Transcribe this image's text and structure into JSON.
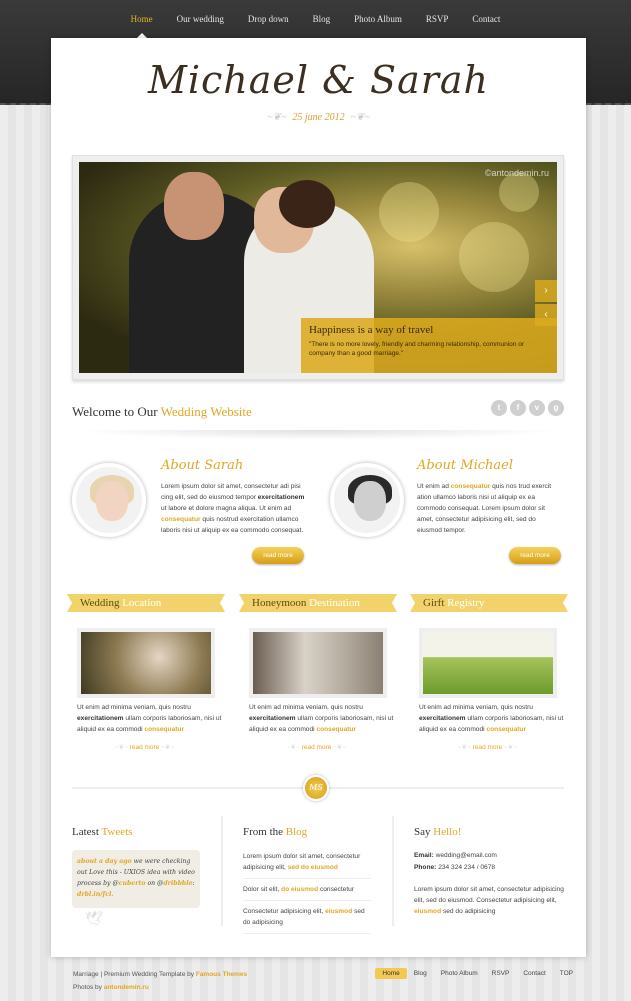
{
  "nav": {
    "items": [
      "Home",
      "Our wedding",
      "Drop down",
      "Blog",
      "Photo Album",
      "RSVP",
      "Contact"
    ],
    "active": "Home"
  },
  "header": {
    "couple_names": "Michael & Sarah",
    "date": "25 june 2012"
  },
  "slider": {
    "watermark": "©antondemin.ru",
    "caption_title": "Happiness is a way of travel",
    "caption_text": "\"There is no more lovely, friendly and charming relationship, communion or company than a good marriage.\"",
    "next_arrow": "›",
    "prev_arrow": "‹"
  },
  "welcome": {
    "prefix": "Welcome to Our ",
    "highlight": "Wedding Website"
  },
  "social": {
    "icons": [
      "twitter-icon",
      "facebook-icon",
      "vimeo-icon",
      "google-icon"
    ],
    "glyphs": [
      "t",
      "f",
      "v",
      "g"
    ]
  },
  "about_sarah": {
    "title": "About Sarah",
    "text1": "Lorem ipsum dolor sit amet, consectetur adi pisi cing elit, sed do eiusmod tempor ",
    "bold1": "exercitationem",
    "text2": " ut labore et dolore magna aliqua. Ut enim ad ",
    "hl": "consequatur",
    "text3": " quis nostrud exercitation ullamco laboris nisi ut aliquip ex ea commodo consequat.",
    "button": "read more"
  },
  "about_michael": {
    "title": "About Michael",
    "text1": "Ut enim ad ",
    "hl": "consequatur",
    "text2": " quis nos trud exercit ation ullamco laboris nisi ut aliquip ex ea commodo consequat. Lorem ipsum dolor sit amet, consectetur adipisicing elit, sed do eiusmod tempor.",
    "button": "read more"
  },
  "features": [
    {
      "title_a": "Wedding ",
      "title_b": "Location",
      "text1": "Ut enim ad minima veniam, quis nostru ",
      "bold": "exercitationem",
      "text2": " ullam corporis laboriosam, nisi ut aliquid ex ea commodi ",
      "hl": "consequatur",
      "more": "read more"
    },
    {
      "title_a": "Honeymoon ",
      "title_b": "Destination",
      "text1": "Ut enim ad minima veniam, quis nostru ",
      "bold": "exercitationem",
      "text2": " ullam corporis laboriosam, nisi ut aliquid ex ea commodi ",
      "hl": "consequatur",
      "more": "read more"
    },
    {
      "title_a": "Girft ",
      "title_b": "Registry",
      "text1": "Ut enim ad minima veniam, quis nostru ",
      "bold": "exercitationem",
      "text2": " ullam corporis laboriosam, nisi ut aliquid ex ea commodi ",
      "hl": "consequatur",
      "more": "read more"
    }
  ],
  "monogram": "MS",
  "tweets": {
    "title_a": "Latest ",
    "title_b": "Tweets",
    "time": "about a day ago",
    "text1": " we were checking out Love this - UXIOS idea with video process by @",
    "user1": "cuberto",
    "text2": " on @",
    "user2": "dribbble",
    "text3": ": ",
    "link": "drbl.in/fcl."
  },
  "blog": {
    "title_a": "From the ",
    "title_b": "Blog",
    "items": [
      {
        "text": "Lorem ipsum dolor sit amet, consectetur adipisicing elit, ",
        "hl": "sed do eiusmod"
      },
      {
        "text": "Dolor sit elit, ",
        "hl": "do eiusmod",
        "text2": " consectetur"
      },
      {
        "text": "Consectetur adipisicing elit, ",
        "hl": "eiusmod",
        "text2": " sed do adipisicing"
      }
    ]
  },
  "contact": {
    "title_a": "Say ",
    "title_b": "Hello!",
    "email_label": "Email:",
    "email": " wedding@email.com",
    "phone_label": "Phone:",
    "phone": " 234 324 234 / 0678",
    "text1": "Lorem ipsum dolor sit amet, consectetur adipisicing elit, sed do eiusmod. Consectetur adipisicing elit, ",
    "hl": "eiusmod",
    "text2": " sed do adipisicing"
  },
  "footer": {
    "line1": "Marriage | Premium Wedding Template by ",
    "brand": "Famous Themes",
    "line2": "Photos by ",
    "photos": "antondemin.ru",
    "nav": [
      "Home",
      "Blog",
      "Photo Album",
      "RSVP",
      "Contact",
      "TOP"
    ],
    "active": "Home"
  },
  "colors": {
    "accent": "#e1a623",
    "dark_bar": "#2e2e2e",
    "gold_button": "#e0b030"
  }
}
